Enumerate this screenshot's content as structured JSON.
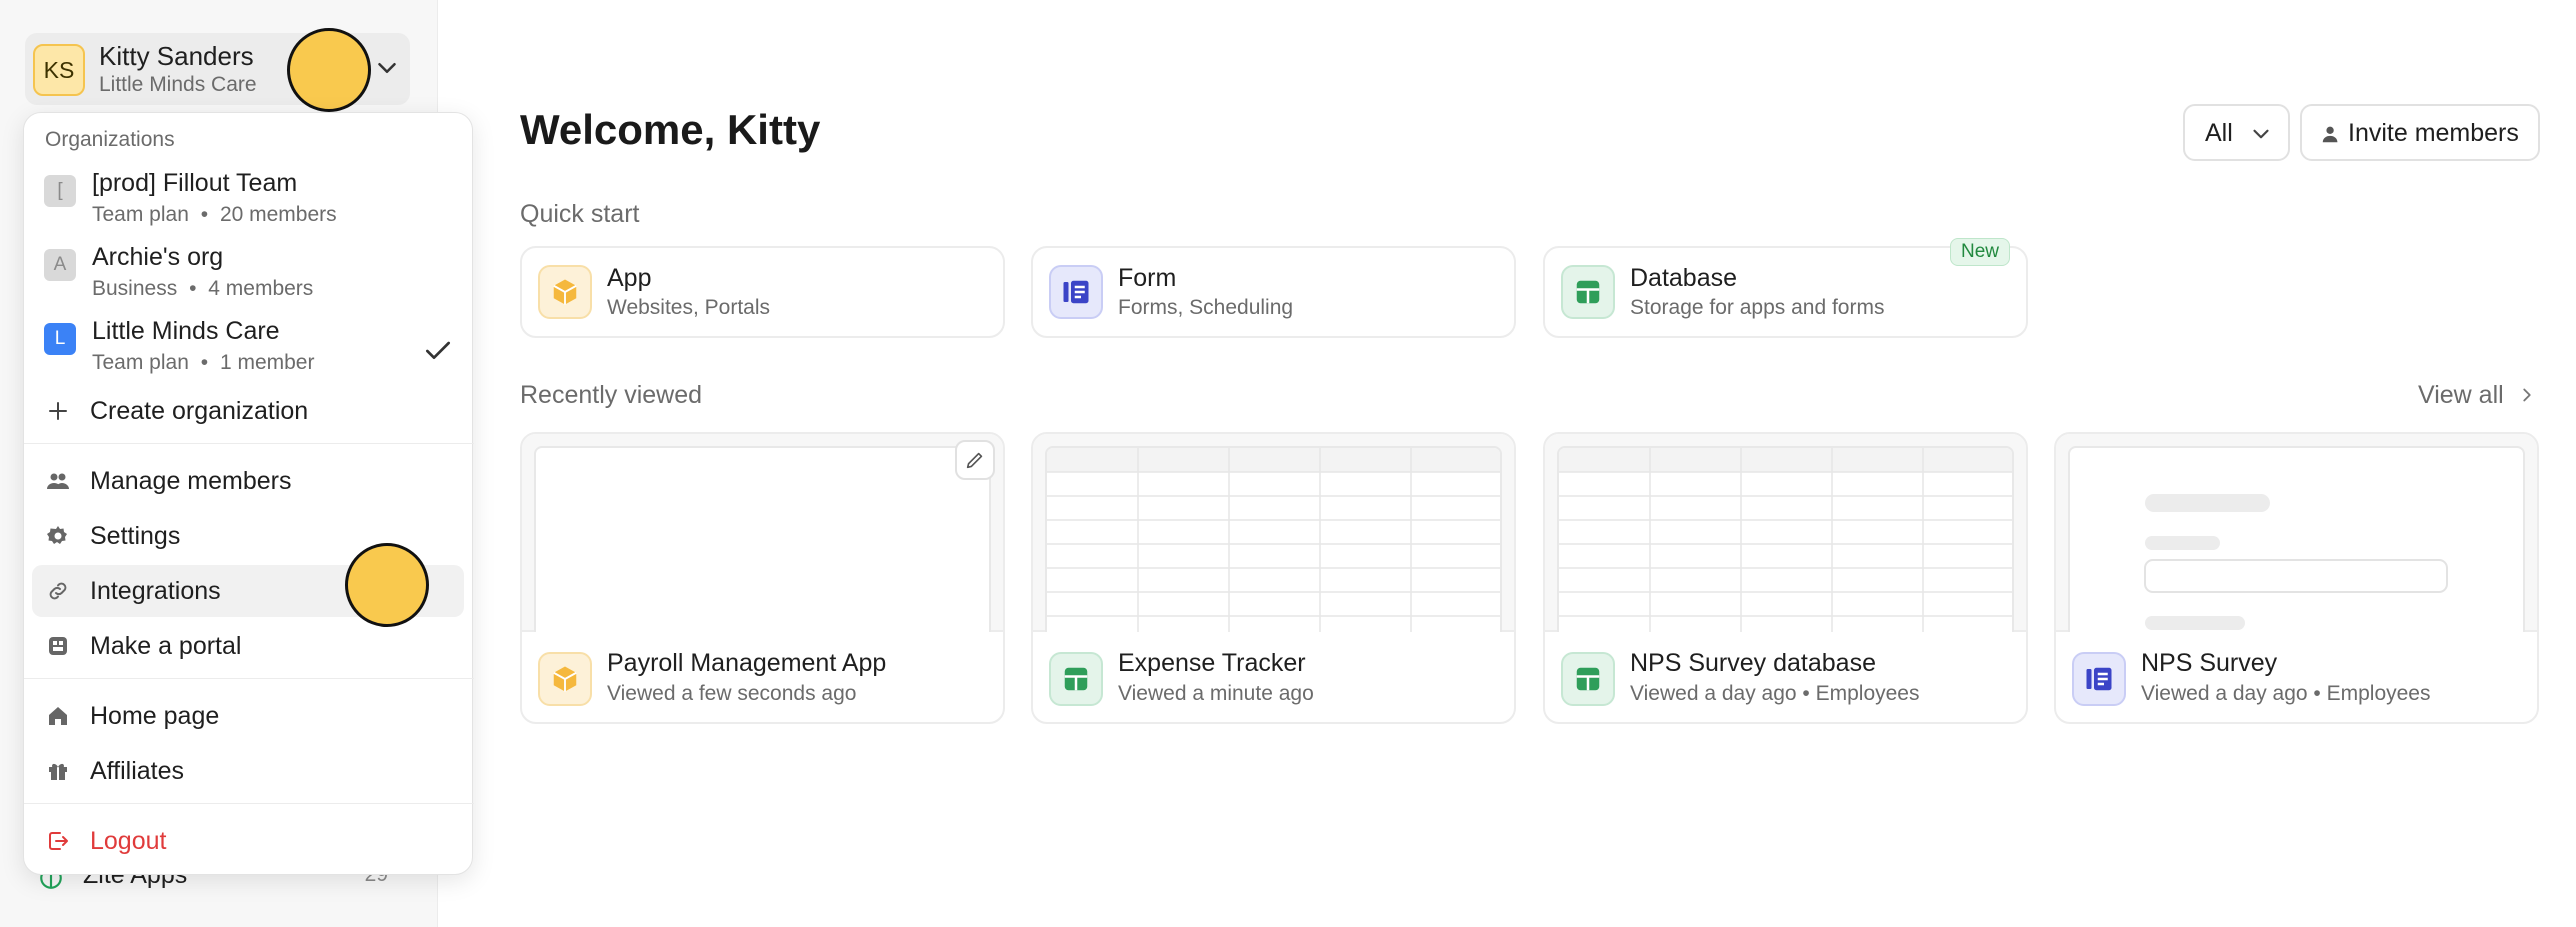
{
  "user": {
    "initials": "KS",
    "name": "Kitty Sanders",
    "org": "Little Minds Care"
  },
  "sidebar": {
    "bottom_item": {
      "label": "Zite Apps",
      "count": "29"
    }
  },
  "dropdown": {
    "section_title": "Organizations",
    "orgs": [
      {
        "initial": "[",
        "name": "[prod] Fillout Team",
        "plan": "Team plan",
        "members": "20 members",
        "selected": false
      },
      {
        "initial": "A",
        "name": "Archie's org",
        "plan": "Business",
        "members": "4 members",
        "selected": false
      },
      {
        "initial": "L",
        "name": "Little Minds Care",
        "plan": "Team plan",
        "members": "1 member",
        "selected": true
      }
    ],
    "meta_separator": "•",
    "create_org": "Create organization",
    "items": [
      {
        "label": "Manage members",
        "icon": "users-icon"
      },
      {
        "label": "Settings",
        "icon": "gear-icon"
      },
      {
        "label": "Integrations",
        "icon": "link-icon"
      },
      {
        "label": "Make a portal",
        "icon": "portal-icon"
      }
    ],
    "items2": [
      {
        "label": "Home page",
        "icon": "home-icon"
      },
      {
        "label": "Affiliates",
        "icon": "gift-icon"
      }
    ],
    "logout": "Logout"
  },
  "main": {
    "welcome": "Welcome, Kitty",
    "filter": {
      "value": "All"
    },
    "invite_label": "Invite members",
    "quick_start_title": "Quick start",
    "quick_start": [
      {
        "title": "App",
        "subtitle": "Websites, Portals",
        "kind": "app"
      },
      {
        "title": "Form",
        "subtitle": "Forms, Scheduling",
        "kind": "form"
      },
      {
        "title": "Database",
        "subtitle": "Storage for apps and forms",
        "kind": "database",
        "badge": "New"
      }
    ],
    "recently_viewed_title": "Recently viewed",
    "view_all": "View all",
    "recent": [
      {
        "title": "Payroll Management App",
        "subtitle": "Viewed a few seconds ago",
        "kind": "app"
      },
      {
        "title": "Expense Tracker",
        "subtitle": "Viewed a minute ago",
        "kind": "database"
      },
      {
        "title": "NPS Survey database",
        "subtitle": "Viewed a day ago • Employees",
        "kind": "database"
      },
      {
        "title": "NPS Survey",
        "subtitle": "Viewed a day ago • Employees",
        "kind": "form"
      }
    ]
  },
  "colors": {
    "accent_yellow": "#f9c94e",
    "logout_red": "#e03b3b",
    "new_badge_green": "#22893f"
  }
}
